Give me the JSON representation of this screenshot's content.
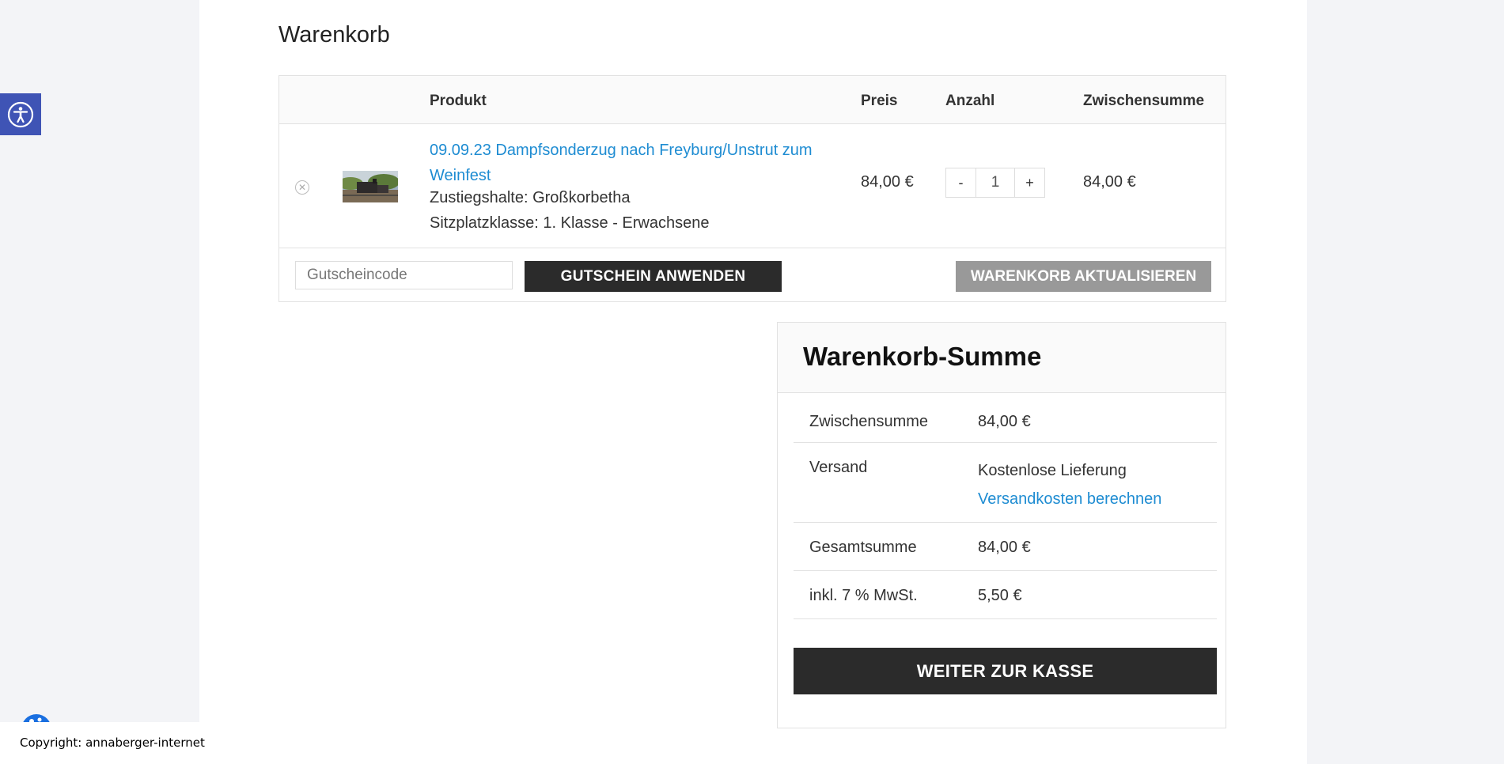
{
  "page": {
    "title": "Warenkorb"
  },
  "cart": {
    "headers": {
      "product": "Produkt",
      "price": "Preis",
      "quantity": "Anzahl",
      "subtotal": "Zwischensumme"
    },
    "items": [
      {
        "remove_icon": "close-circle-icon",
        "thumbnail": "steam-train-photo",
        "name": "09.09.23 Dampfsonderzug nach Freyburg/Unstrut zum Weinfest",
        "meta_1": "Zustiegshalte: Großkorbetha",
        "meta_2": "Sitzplatzklasse: 1. Klasse - Erwachsene",
        "price": "84,00 €",
        "qty_minus": "-",
        "qty_value": "1",
        "qty_plus": "+",
        "subtotal": "84,00 €"
      }
    ],
    "coupon_placeholder": "Gutscheincode",
    "apply_coupon_label": "GUTSCHEIN ANWENDEN",
    "update_cart_label": "WARENKORB AKTUALISIEREN"
  },
  "totals": {
    "title": "Warenkorb-Summe",
    "subtotal_label": "Zwischensumme",
    "subtotal_value": "84,00 €",
    "shipping_label": "Versand",
    "shipping_value": "Kostenlose Lieferung",
    "shipping_link": "Versandkosten berechnen",
    "total_label": "Gesamtsumme",
    "total_value": "84,00 €",
    "tax_label": "inkl. 7 % MwSt.",
    "tax_value": "5,50 €",
    "checkout_label": "WEITER ZUR KASSE"
  },
  "widgets": {
    "accessibility_icon": "accessibility-icon",
    "copyright": "Copyright: annaberger-internet"
  },
  "colors": {
    "link": "#1e8cd2",
    "button_dark": "#2b2b2b",
    "button_grey": "#999999",
    "a11y": "#3f54b5"
  }
}
